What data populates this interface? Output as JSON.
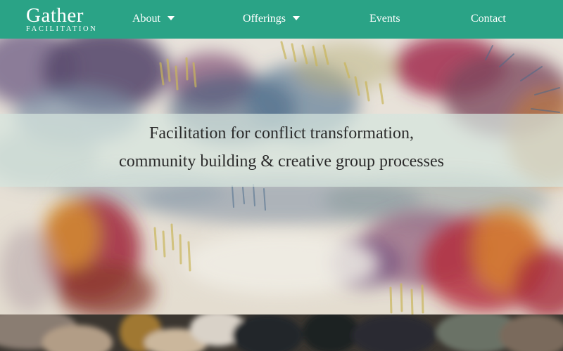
{
  "brand": {
    "name": "Gather",
    "tagline": "FACILITATION"
  },
  "nav": [
    {
      "label": "About",
      "dropdown": true,
      "icon": "caret-down-icon"
    },
    {
      "label": "Offerings",
      "dropdown": true,
      "icon": "caret-down-icon"
    },
    {
      "label": "Events",
      "dropdown": false
    },
    {
      "label": "Contact",
      "dropdown": false
    }
  ],
  "hero": {
    "line1": "Facilitation for conflict transformation,",
    "line2": "community building & creative group processes"
  },
  "colors": {
    "brand_green": "#2aa386",
    "nav_text": "#ffffff",
    "band": "#d6e4de",
    "tagline_text": "#2b2b2b"
  }
}
